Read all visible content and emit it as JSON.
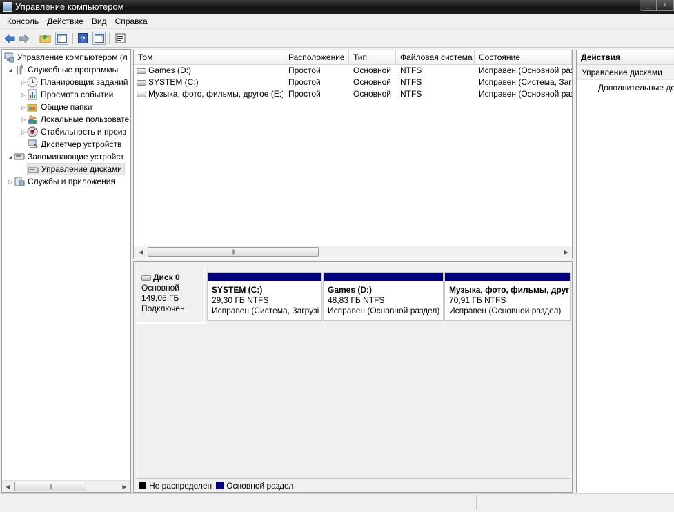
{
  "window": {
    "title": "Управление компьютером"
  },
  "menu": [
    "Консоль",
    "Действие",
    "Вид",
    "Справка"
  ],
  "tree": {
    "root": "Управление компьютером (л",
    "system_tools": "Служебные программы",
    "task_scheduler": "Планировщик заданий",
    "event_viewer": "Просмотр событий",
    "shared_folders": "Общие папки",
    "local_users": "Локальные пользовате",
    "reliability": "Стабильность и произ",
    "device_manager": "Диспетчер устройств",
    "storage": "Запоминающие устройст",
    "disk_management": "Управление дисками",
    "services_apps": "Службы и приложения"
  },
  "volumes": {
    "columns": [
      "Том",
      "Расположение",
      "Тип",
      "Файловая система",
      "Состояние"
    ],
    "rows": [
      [
        "Games (D:)",
        "Простой",
        "Основной",
        "NTFS",
        "Исправен (Основной раз"
      ],
      [
        "SYSTEM (C:)",
        "Простой",
        "Основной",
        "NTFS",
        "Исправен (Система, Загр"
      ],
      [
        "Музыка, фото, фильмы, другое (E:)",
        "Простой",
        "Основной",
        "NTFS",
        "Исправен (Основной раз"
      ]
    ]
  },
  "disk0": {
    "name": "Диск 0",
    "type": "Основной",
    "size": "149,05 ГБ",
    "status": "Подключен",
    "partitions": [
      {
        "name": "SYSTEM  (C:)",
        "size": "29,30 ГБ NTFS",
        "status": "Исправен (Система, Загрузі"
      },
      {
        "name": "Games  (D:)",
        "size": "48,83 ГБ NTFS",
        "status": "Исправен (Основной раздел)"
      },
      {
        "name": "Музыка, фото, фильмы, друг",
        "size": "70,91 ГБ NTFS",
        "status": "Исправен (Основной раздел)"
      }
    ]
  },
  "legend": {
    "unallocated": "Не распределен",
    "primary": "Основной раздел"
  },
  "actions": {
    "header": "Действия",
    "group": "Управление дисками",
    "more": "Дополнительные де"
  },
  "colors": {
    "primary_partition": "#00007f",
    "unallocated": "#000000"
  }
}
